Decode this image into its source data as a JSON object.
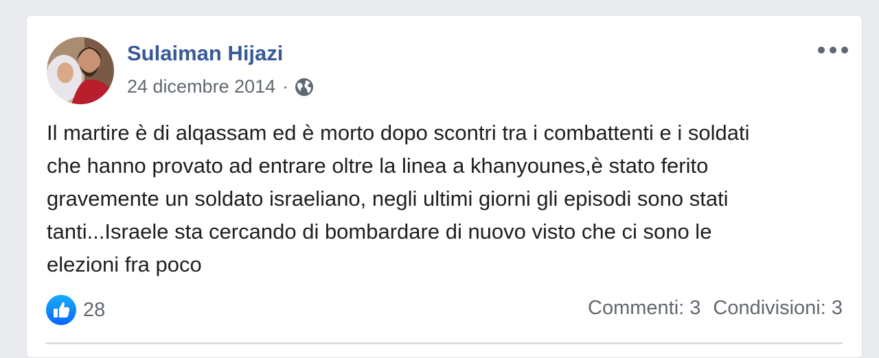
{
  "post": {
    "author": "Sulaiman Hijazi",
    "date": "24 dicembre 2014",
    "separator": "·",
    "privacy_icon": "globe-icon",
    "menu_icon": "more-options-icon",
    "text_lines": [
      "Il martire è di alqassam ed è morto dopo scontri tra i combattenti e i soldati",
      "che hanno provato ad entrare oltre la linea a khanyounes,è stato ferito",
      "gravemente un soldato israeliano, negli ultimi giorni gli episodi sono stati",
      "tanti...Israele sta cercando di bombardare di nuovo visto che ci sono le",
      "elezioni fra poco"
    ]
  },
  "reactions": {
    "icon": "like-icon",
    "count": "28"
  },
  "stats": {
    "comments": "Commenti: 3",
    "shares": "Condivisioni: 3"
  },
  "colors": {
    "author": "#385898",
    "like_blue": "#1877f2",
    "meta_gray": "#606770"
  }
}
